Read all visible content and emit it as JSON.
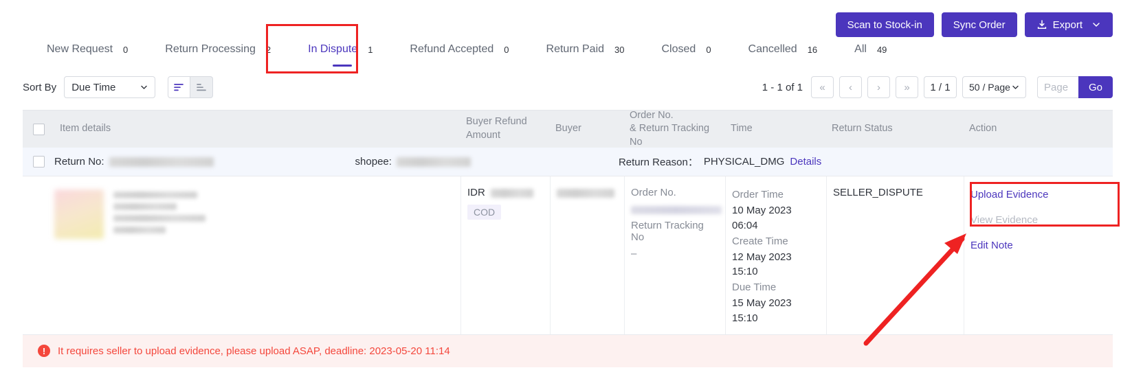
{
  "toolbar": {
    "scan_label": "Scan to Stock-in",
    "sync_label": "Sync Order",
    "export_label": "Export"
  },
  "tabs": [
    {
      "label": "New Request",
      "count": "0",
      "active": false
    },
    {
      "label": "Return Processing",
      "count": "2",
      "active": false
    },
    {
      "label": "In Dispute",
      "count": "1",
      "active": true
    },
    {
      "label": "Refund Accepted",
      "count": "0",
      "active": false
    },
    {
      "label": "Return Paid",
      "count": "30",
      "active": false
    },
    {
      "label": "Closed",
      "count": "0",
      "active": false
    },
    {
      "label": "Cancelled",
      "count": "16",
      "active": false
    },
    {
      "label": "All",
      "count": "49",
      "active": false
    }
  ],
  "controls": {
    "sort_by_label": "Sort By",
    "sort_by_value": "Due Time",
    "sort_asc_name": "sort-ascending",
    "sort_desc_name": "sort-descending"
  },
  "pagination": {
    "range": "1 - 1 of 1",
    "first_label": "«",
    "prev_label": "‹",
    "next_label": "›",
    "last_label": "»",
    "page_indicator": "1 / 1",
    "page_size": "50 / Page",
    "page_placeholder": "Page",
    "page_value": "",
    "go_label": "Go"
  },
  "table": {
    "headers": {
      "item_details": "Item details",
      "buyer_refund_amount": "Buyer Refund\nAmount",
      "buyer_refund_line1": "Buyer Refund",
      "buyer_refund_line2": "Amount",
      "buyer": "Buyer",
      "order_line1": "Order No.",
      "order_line2": "& Return Tracking No",
      "time": "Time",
      "return_status": "Return Status",
      "action": "Action"
    },
    "row": {
      "return_no_label": "Return No:",
      "return_no_value": "",
      "shopee_label": "shopee:",
      "shopee_value": "",
      "return_reason_label": "Return Reason：",
      "return_reason_value": "PHYSICAL_DMG",
      "details_link": "Details",
      "currency": "IDR",
      "amount_value": "",
      "cod_badge": "COD",
      "buyer_value": "",
      "order_no_label": "Order No.",
      "order_no_value": "",
      "return_tracking_label": "Return Tracking No",
      "return_tracking_value": "–",
      "order_time_label": "Order Time",
      "order_time_date": "10 May 2023",
      "order_time_clock": "06:04",
      "create_time_label": "Create Time",
      "create_time_date": "12 May 2023",
      "create_time_clock": "15:10",
      "due_time_label": "Due Time",
      "due_time_date": "15 May 2023",
      "due_time_clock": "15:10",
      "return_status": "SELLER_DISPUTE",
      "upload_evidence": "Upload Evidence",
      "view_evidence": "View Evidence",
      "edit_note": "Edit Note"
    }
  },
  "warning": {
    "icon": "exclamation-circle-icon",
    "text": "It requires seller to upload evidence, please upload ASAP, deadline: 2023-05-20 11:14"
  },
  "colors": {
    "accent": "#4b36bd",
    "annotation": "#ee2222",
    "warning": "#f4473c",
    "header_bg": "#eceef1",
    "subrow_bg": "#f4f7fd"
  }
}
